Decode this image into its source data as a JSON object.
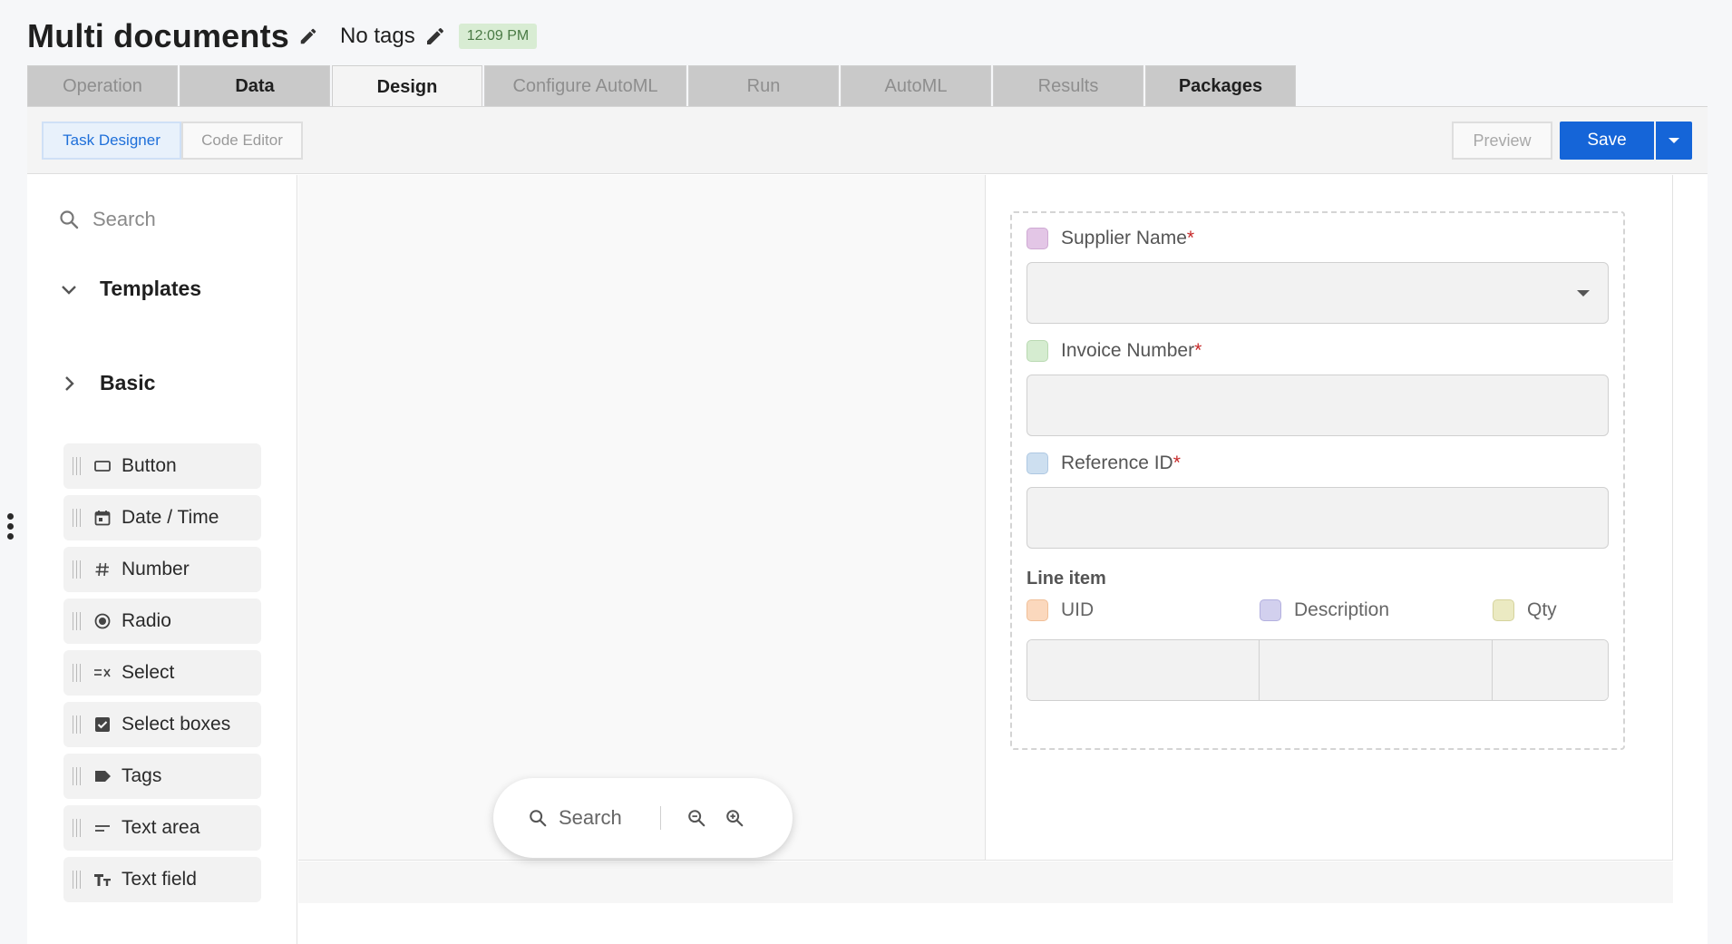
{
  "header": {
    "title": "Multi documents",
    "tags_label": "No tags",
    "time_badge": "12:09 PM"
  },
  "tabs": [
    {
      "label": "Operation",
      "state": "disabled"
    },
    {
      "label": "Data",
      "state": "enabled"
    },
    {
      "label": "Design",
      "state": "active"
    },
    {
      "label": "Configure AutoML",
      "state": "disabled"
    },
    {
      "label": "Run",
      "state": "disabled"
    },
    {
      "label": "AutoML",
      "state": "disabled"
    },
    {
      "label": "Results",
      "state": "disabled"
    },
    {
      "label": "Packages",
      "state": "enabled"
    }
  ],
  "toolbar": {
    "task_designer": "Task Designer",
    "code_editor": "Code Editor",
    "preview": "Preview",
    "save": "Save"
  },
  "sidebar": {
    "search_placeholder": "Search",
    "groups": {
      "templates": "Templates",
      "basic": "Basic"
    },
    "components": [
      {
        "label": "Button",
        "icon": "button-icon"
      },
      {
        "label": "Date / Time",
        "icon": "calendar-icon"
      },
      {
        "label": "Number",
        "icon": "hash-icon"
      },
      {
        "label": "Radio",
        "icon": "radio-icon"
      },
      {
        "label": "Select",
        "icon": "select-icon"
      },
      {
        "label": "Select boxes",
        "icon": "checkbox-icon"
      },
      {
        "label": "Tags",
        "icon": "tag-icon"
      },
      {
        "label": "Text area",
        "icon": "text-area-icon"
      },
      {
        "label": "Text field",
        "icon": "text-field-icon"
      }
    ]
  },
  "canvas": {
    "search_label": "Search"
  },
  "form": {
    "fields": [
      {
        "label": "Supplier Name",
        "required": "*",
        "swatch": "#e3c6e6",
        "type": "select"
      },
      {
        "label": "Invoice Number",
        "required": "*",
        "swatch": "#d5ecd0",
        "type": "text"
      },
      {
        "label": "Reference ID",
        "required": "*",
        "swatch": "#cddff0",
        "type": "text"
      }
    ],
    "line_item": {
      "title": "Line item",
      "columns": [
        {
          "label": "UID",
          "swatch": "#fbd8bd"
        },
        {
          "label": "Description",
          "swatch": "#d2d0ee"
        },
        {
          "label": "Qty",
          "swatch": "#ebeac2"
        }
      ]
    }
  },
  "colors": {
    "accent": "#1565d8",
    "time_badge_bg": "#d8ecd3",
    "time_badge_text": "#4a7a45",
    "required": "#c62828"
  }
}
